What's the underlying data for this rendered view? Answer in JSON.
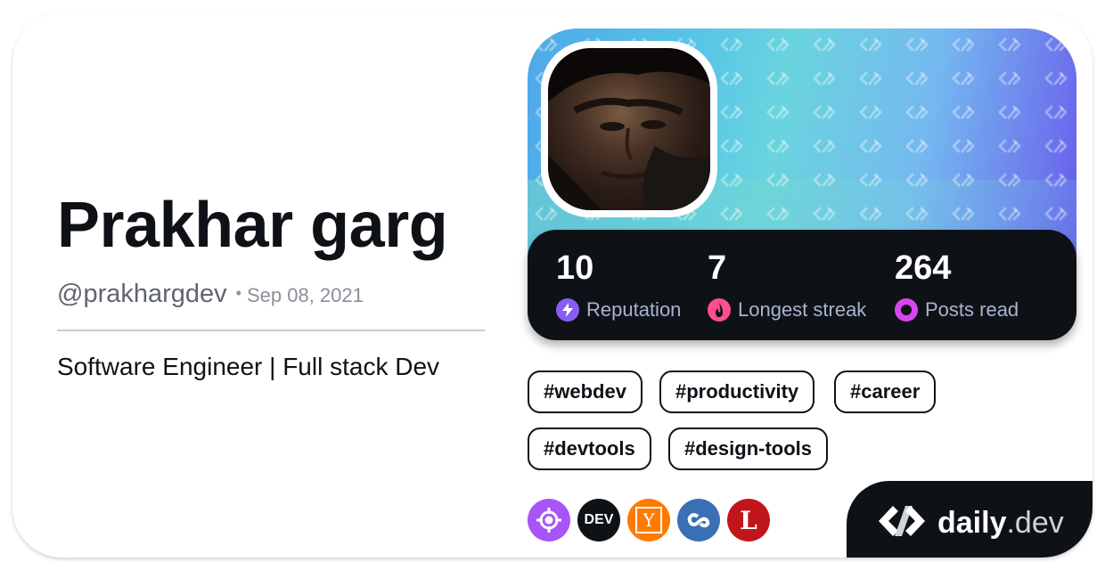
{
  "profile": {
    "name": "Prakhar garg",
    "handle": "@prakhargdev",
    "separator": "•",
    "joined": "Sep 08, 2021",
    "bio": "Software Engineer | Full stack Dev"
  },
  "stats": [
    {
      "value": "10",
      "label": "Reputation",
      "icon": "lightning-icon",
      "color": "#8a5cf6"
    },
    {
      "value": "7",
      "label": "Longest streak",
      "icon": "flame-icon",
      "color": "#ff4f8b"
    },
    {
      "value": "264",
      "label": "Posts read",
      "icon": "ring-icon",
      "color": "#d946ef"
    }
  ],
  "tags": [
    "#webdev",
    "#productivity",
    "#career",
    "#devtools",
    "#design-tools"
  ],
  "sources": [
    {
      "name": "crosshair-source-icon",
      "text": "",
      "color": "#a855f7"
    },
    {
      "name": "dev-source-icon",
      "text": "DEV",
      "color": "#0e1217"
    },
    {
      "name": "hackernews-source-icon",
      "text": "Y",
      "color": "#ff7a00"
    },
    {
      "name": "link-source-icon",
      "text": "",
      "color": "#3b6fb6"
    },
    {
      "name": "l-source-icon",
      "text": "L",
      "color": "#c0151b"
    }
  ],
  "brand": {
    "main": "daily",
    "suffix": ".dev"
  }
}
